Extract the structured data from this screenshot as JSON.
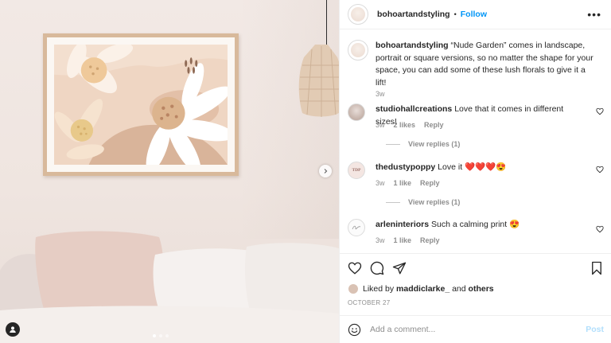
{
  "post_header": {
    "username": "bohoartandstyling",
    "separator": "•",
    "follow_label": "Follow",
    "more_icon": "more-horizontal-icon"
  },
  "caption": {
    "username": "bohoartandstyling",
    "text": "“Nude Garden” comes in landscape, portrait or square versions, so no matter the shape for your space, you can add some of these lush florals to give it a lift!",
    "time": "3w"
  },
  "comments": [
    {
      "username": "studiohallcreations",
      "text": "Love that it comes in different sizes!",
      "time": "3w",
      "likes": "2 likes",
      "reply": "Reply",
      "view_replies": "View replies (1)"
    },
    {
      "username": "thedustypoppy",
      "text": "Love it ❤️❤️❤️😍",
      "time": "3w",
      "likes": "1 like",
      "reply": "Reply",
      "view_replies": "View replies (1)",
      "avatar_text": "TDP"
    },
    {
      "username": "arleninteriors",
      "text": "Such a calming print 😍",
      "time": "3w",
      "likes": "1 like",
      "reply": "Reply"
    }
  ],
  "likes_line": {
    "prefix": "Liked by",
    "user": "maddiclarke_",
    "joiner": "and",
    "others": "others"
  },
  "date": "OCTOBER 27",
  "add_comment": {
    "placeholder": "Add a comment...",
    "post_label": "Post"
  },
  "colors": {
    "accent": "#0095f6",
    "post_disabled": "#b2dffc",
    "text": "#262626",
    "muted": "#8e8e8e"
  }
}
